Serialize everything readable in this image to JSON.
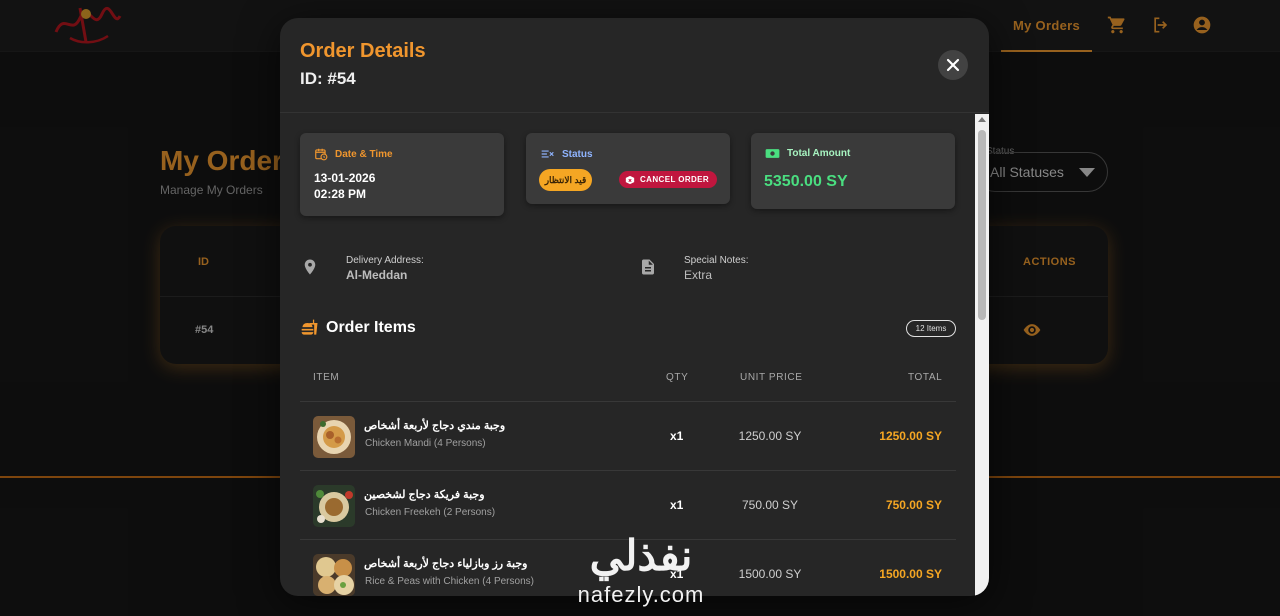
{
  "header": {
    "logo_text": "مطاعم",
    "nav_my_orders": "My Orders",
    "icons": [
      "cart-icon",
      "logout-icon",
      "account-icon"
    ]
  },
  "background_page": {
    "title": "My Orders",
    "subtitle": "Manage My Orders",
    "filter_label": "Status",
    "filter_value": "All Statuses",
    "table_headers": {
      "id": "ID",
      "actions": "ACTIONS"
    },
    "row": {
      "id": "#54"
    }
  },
  "modal": {
    "title": "Order Details",
    "order_id": "ID: #54",
    "date_time": {
      "label": "Date & Time",
      "date": "13-01-2026",
      "time": "02:28 PM"
    },
    "status": {
      "label": "Status",
      "value": "قيد الانتظار",
      "cancel_label": "CANCEL ORDER"
    },
    "total": {
      "label": "Total Amount",
      "value": "5350.00 SY"
    },
    "delivery": {
      "label": "Delivery Address:",
      "value": "Al-Meddan"
    },
    "notes": {
      "label": "Special Notes:",
      "value": "Extra"
    },
    "items_title": "Order Items",
    "items_count": "12 Items",
    "columns": {
      "item": "ITEM",
      "qty": "QTY",
      "unit_price": "UNIT PRICE",
      "total": "TOTAL"
    },
    "items": [
      {
        "name_ar": "وجبة مندي دجاج لأربعة أشخاص",
        "name_en": "Chicken Mandi (4 Persons)",
        "qty": "x1",
        "unit_price": "1250.00 SY",
        "total": "1250.00 SY"
      },
      {
        "name_ar": "وجبة فريكة دجاج لشخصين",
        "name_en": "Chicken Freekeh (2 Persons)",
        "qty": "x1",
        "unit_price": "750.00 SY",
        "total": "750.00 SY"
      },
      {
        "name_ar": "وجبة رز وبازلياء دجاج لأربعة أشخاص",
        "name_en": "Rice & Peas with Chicken (4 Persons)",
        "qty": "x1",
        "unit_price": "1500.00 SY",
        "total": "1500.00 SY"
      }
    ]
  },
  "watermark": {
    "arabic": "نفذلي",
    "latin": "nafezly.com"
  },
  "colors": {
    "accent": "#e8962e",
    "success": "#4ade80",
    "danger": "#c0163e",
    "pending": "#f5a623"
  }
}
